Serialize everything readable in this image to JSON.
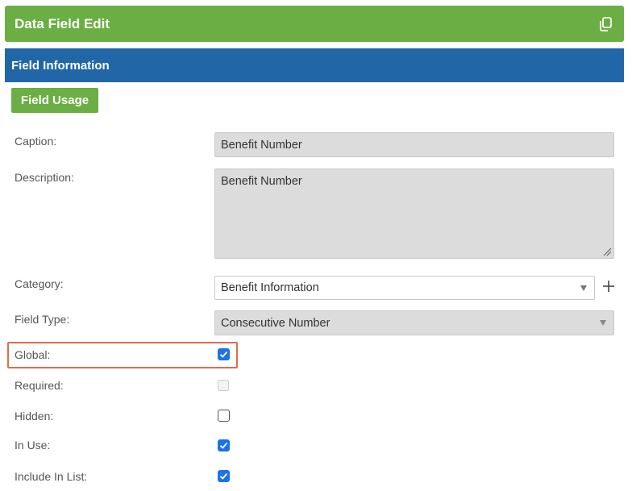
{
  "panel": {
    "title": "Data Field Edit",
    "header_color": "#6bae43",
    "copy_icon": "copy-icon"
  },
  "section": {
    "title": "Field Information",
    "header_color": "#2167a8"
  },
  "field_usage_button": {
    "label": "Field Usage"
  },
  "fields": {
    "caption": {
      "label": "Caption:",
      "value": "Benefit Number"
    },
    "description": {
      "label": "Description:",
      "value": "Benefit Number"
    },
    "category": {
      "label": "Category:",
      "value": "Benefit Information"
    },
    "field_type": {
      "label": "Field Type:",
      "value": "Consecutive Number"
    }
  },
  "checkboxes": {
    "global": {
      "label": "Global:",
      "checked": true,
      "highlighted": true
    },
    "required": {
      "label": "Required:",
      "checked": false,
      "disabled": true
    },
    "hidden": {
      "label": "Hidden:",
      "checked": false
    },
    "in_use": {
      "label": "In Use:",
      "checked": true
    },
    "include_in_list": {
      "label": "Include In List:",
      "checked": true
    }
  },
  "colors": {
    "accent_green": "#6bae43",
    "accent_blue": "#2167a8",
    "checkbox_blue": "#1a73e8",
    "highlight_orange": "#d9704f"
  }
}
